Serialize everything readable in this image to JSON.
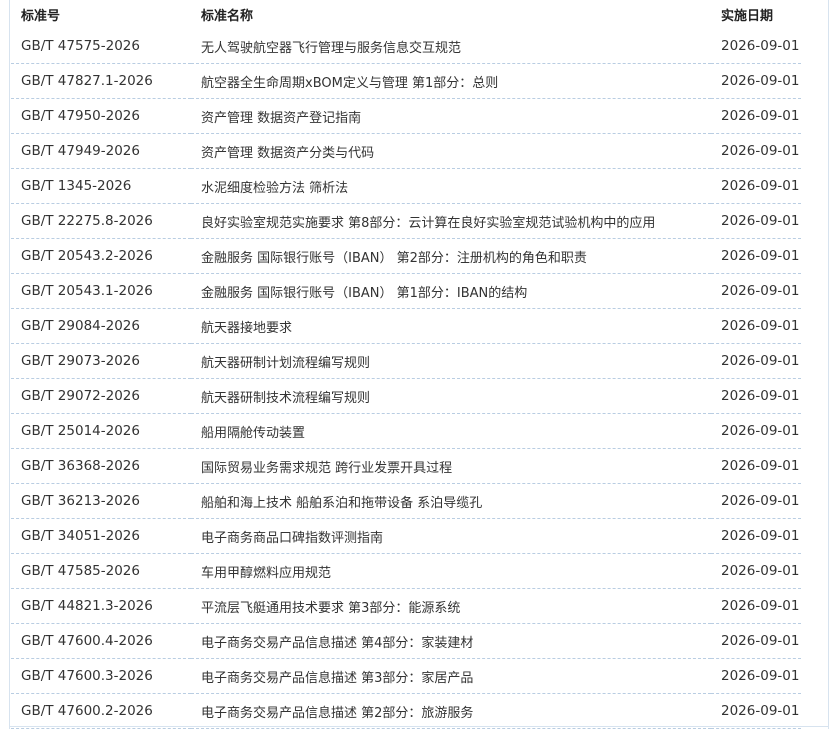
{
  "table": {
    "headers": {
      "code": "标准号",
      "name": "标准名称",
      "date": "实施日期"
    },
    "rows": [
      {
        "code": "GB/T 47575-2026",
        "name": "无人驾驶航空器飞行管理与服务信息交互规范",
        "date": "2026-09-01"
      },
      {
        "code": "GB/T 47827.1-2026",
        "name": "航空器全生命周期xBOM定义与管理 第1部分：总则",
        "date": "2026-09-01"
      },
      {
        "code": "GB/T 47950-2026",
        "name": "资产管理 数据资产登记指南",
        "date": "2026-09-01"
      },
      {
        "code": "GB/T 47949-2026",
        "name": "资产管理 数据资产分类与代码",
        "date": "2026-09-01"
      },
      {
        "code": "GB/T 1345-2026",
        "name": "水泥细度检验方法 筛析法",
        "date": "2026-09-01"
      },
      {
        "code": "GB/T 22275.8-2026",
        "name": "良好实验室规范实施要求 第8部分：云计算在良好实验室规范试验机构中的应用",
        "date": "2026-09-01"
      },
      {
        "code": "GB/T 20543.2-2026",
        "name": "金融服务 国际银行账号（IBAN） 第2部分：注册机构的角色和职责",
        "date": "2026-09-01"
      },
      {
        "code": "GB/T 20543.1-2026",
        "name": "金融服务 国际银行账号（IBAN） 第1部分：IBAN的结构",
        "date": "2026-09-01"
      },
      {
        "code": "GB/T 29084-2026",
        "name": "航天器接地要求",
        "date": "2026-09-01"
      },
      {
        "code": "GB/T 29073-2026",
        "name": "航天器研制计划流程编写规则",
        "date": "2026-09-01"
      },
      {
        "code": "GB/T 29072-2026",
        "name": "航天器研制技术流程编写规则",
        "date": "2026-09-01"
      },
      {
        "code": "GB/T 25014-2026",
        "name": "船用隔舱传动装置",
        "date": "2026-09-01"
      },
      {
        "code": "GB/T 36368-2026",
        "name": "国际贸易业务需求规范 跨行业发票开具过程",
        "date": "2026-09-01"
      },
      {
        "code": "GB/T 36213-2026",
        "name": "船舶和海上技术 船舶系泊和拖带设备 系泊导缆孔",
        "date": "2026-09-01"
      },
      {
        "code": "GB/T 34051-2026",
        "name": "电子商务商品口碑指数评测指南",
        "date": "2026-09-01"
      },
      {
        "code": "GB/T 47585-2026",
        "name": "车用甲醇燃料应用规范",
        "date": "2026-09-01"
      },
      {
        "code": "GB/T 44821.3-2026",
        "name": "平流层飞艇通用技术要求 第3部分：能源系统",
        "date": "2026-09-01"
      },
      {
        "code": "GB/T 47600.4-2026",
        "name": "电子商务交易产品信息描述 第4部分：家装建材",
        "date": "2026-09-01"
      },
      {
        "code": "GB/T 47600.3-2026",
        "name": "电子商务交易产品信息描述 第3部分：家居产品",
        "date": "2026-09-01"
      },
      {
        "code": "GB/T 47600.2-2026",
        "name": "电子商务交易产品信息描述 第2部分：旅游服务",
        "date": "2026-09-01"
      }
    ]
  }
}
